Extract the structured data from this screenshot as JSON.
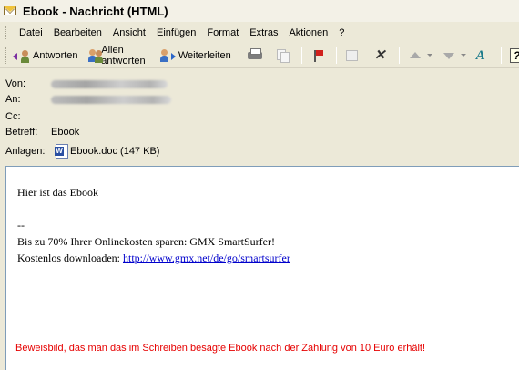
{
  "window": {
    "title": "Ebook - Nachricht (HTML)"
  },
  "menu": [
    "Datei",
    "Bearbeiten",
    "Ansicht",
    "Einfügen",
    "Format",
    "Extras",
    "Aktionen",
    "?"
  ],
  "toolbar": {
    "reply": "Antworten",
    "reply_all": "Allen antworten",
    "forward": "Weiterleiten"
  },
  "header": {
    "from_label": "Von:",
    "to_label": "An:",
    "cc_label": "Cc:",
    "subject_label": "Betreff:",
    "subject_value": "Ebook",
    "attachments_label": "Anlagen:",
    "attachment_name": "Ebook.doc (147 KB)"
  },
  "body": {
    "greeting": "Hier ist das Ebook",
    "sig_sep": "--",
    "ad_line": "Bis zu 70% Ihrer Onlinekosten sparen: GMX SmartSurfer!",
    "download_prefix": "Kostenlos downloaden: ",
    "download_link": "http://www.gmx.net/de/go/smartsurfer",
    "caption": "Beweisbild, das man das im Schreiben besagte Ebook nach der Zahlung von 10 Euro erhält!"
  },
  "colors": {
    "caption": "#e60000",
    "link": "#0000cc"
  }
}
